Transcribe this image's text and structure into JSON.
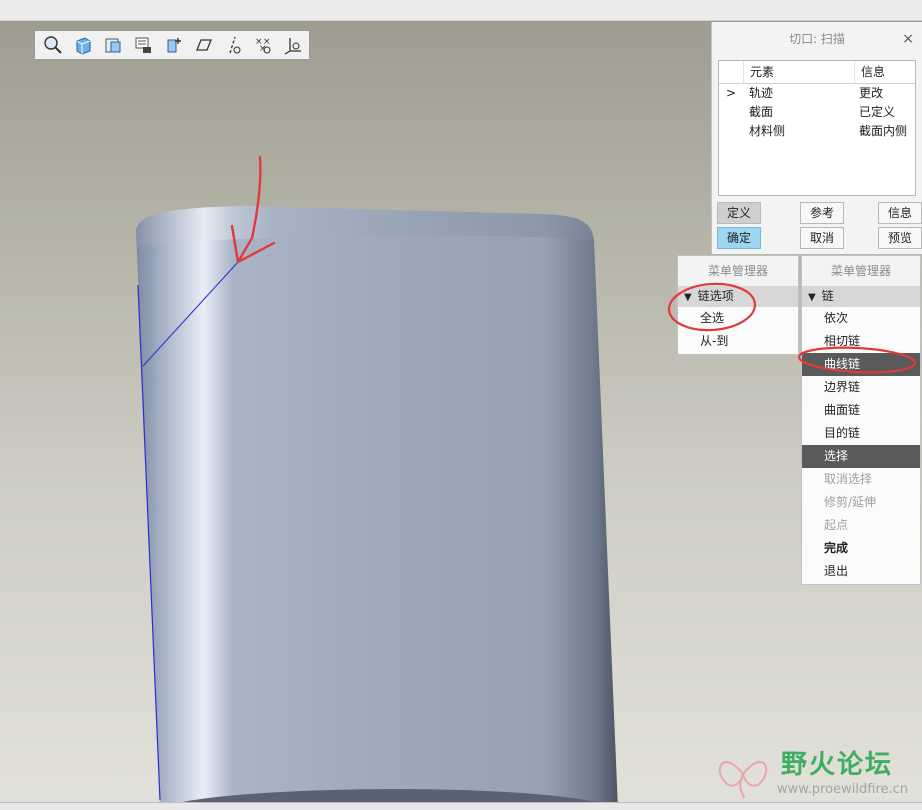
{
  "toolbar": {
    "icons": [
      "zoom-icon",
      "solid-view-icon",
      "saved-view-icon",
      "layers-icon",
      "datum-point-icon",
      "plane-icon",
      "axis-icon",
      "points-icon",
      "csys-icon"
    ]
  },
  "dialog": {
    "title": "切口: 扫描",
    "close": "×",
    "columns": {
      "element": "元素",
      "info": "信息"
    },
    "rows": [
      {
        "marker": ">",
        "element": "轨迹",
        "info": "更改"
      },
      {
        "marker": "",
        "element": "截面",
        "info": "已定义"
      },
      {
        "marker": "",
        "element": "材料侧",
        "info": "截面内侧"
      }
    ],
    "buttons": {
      "define": "定义",
      "refs": "参考",
      "info": "信息",
      "ok": "确定",
      "cancel": "取消",
      "preview": "预览"
    }
  },
  "menu_left": {
    "title": "菜单管理器",
    "header": "链选项",
    "items": [
      "全选",
      "从-到"
    ]
  },
  "menu_right": {
    "title": "菜单管理器",
    "header": "链",
    "items": [
      {
        "label": "依次",
        "state": "normal"
      },
      {
        "label": "相切链",
        "state": "normal"
      },
      {
        "label": "曲线链",
        "state": "selected"
      },
      {
        "label": "边界链",
        "state": "normal"
      },
      {
        "label": "曲面链",
        "state": "normal"
      },
      {
        "label": "目的链",
        "state": "normal"
      },
      {
        "label": "选择",
        "state": "selected"
      },
      {
        "label": "取消选择",
        "state": "disabled"
      },
      {
        "label": "修剪/延伸",
        "state": "disabled"
      },
      {
        "label": "起点",
        "state": "disabled"
      },
      {
        "label": "完成",
        "state": "bold"
      },
      {
        "label": "退出",
        "state": "normal"
      }
    ]
  },
  "watermark": {
    "name": "野火论坛",
    "url": "www.proewildfire.cn"
  },
  "colors": {
    "annotation": "#e03a3a",
    "selection_edge": "#2a2ad8",
    "highlight": "#9ed6f2",
    "model_surface": "#9aa7ba"
  }
}
